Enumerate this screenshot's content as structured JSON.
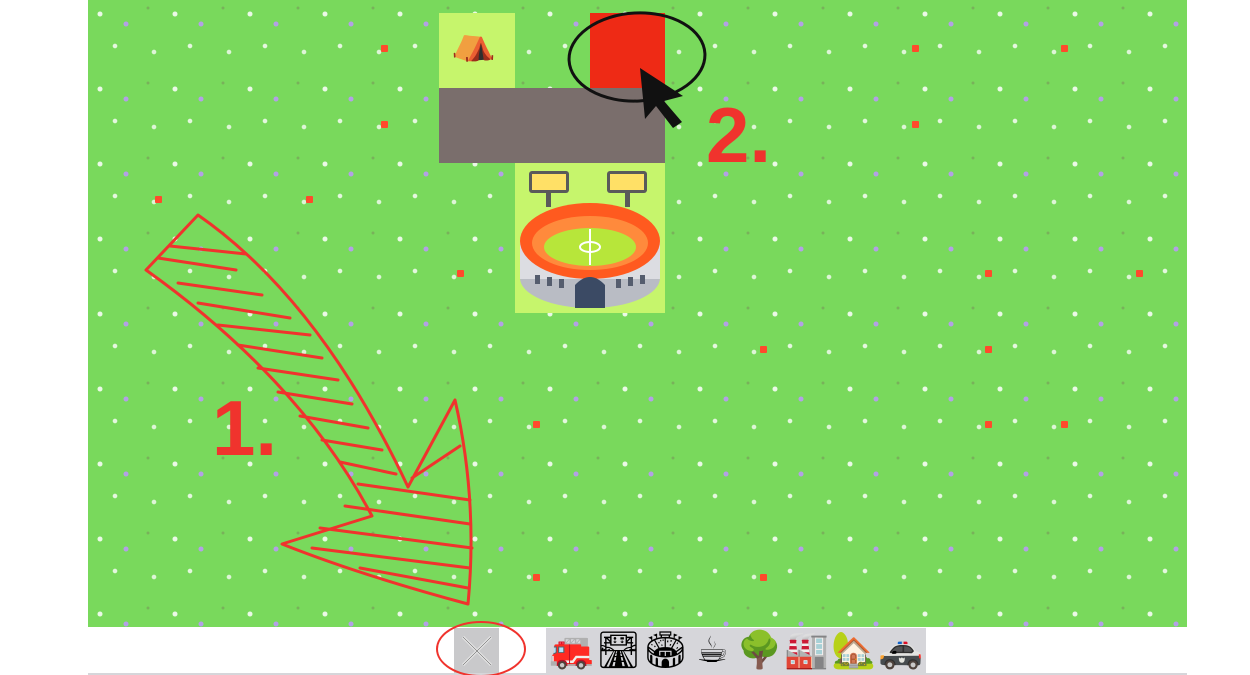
{
  "board": {
    "grass_color": "#79d95c",
    "red_dot_color": "#ff4a2c"
  },
  "placed_tiles": {
    "tent": {
      "icon": "tent-icon",
      "glyph": "⛺"
    },
    "road": {
      "icon": "road-tile"
    },
    "selected_block": {
      "icon": "red-selection-block",
      "color": "#ee2a15"
    },
    "stadium": {
      "icon": "stadium-icon"
    }
  },
  "toolbar": {
    "close_icon": "close-icon",
    "tools": [
      {
        "name": "fire-engine-icon",
        "glyph": "🚒"
      },
      {
        "name": "motorway-icon",
        "glyph": "🛣"
      },
      {
        "name": "stadium-icon",
        "glyph": "🏟"
      },
      {
        "name": "coffee-icon",
        "glyph": "☕"
      },
      {
        "name": "tree-icon",
        "glyph": "🌳"
      },
      {
        "name": "factory-icon",
        "glyph": "🏭"
      },
      {
        "name": "house-icon",
        "glyph": "🏡"
      },
      {
        "name": "police-car-icon",
        "glyph": "🚓"
      }
    ]
  },
  "annotations": {
    "step_1": "1.",
    "step_2": "2.",
    "annotation_color": "#f0332d"
  }
}
